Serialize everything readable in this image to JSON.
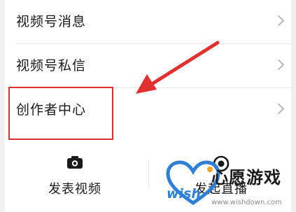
{
  "menu": {
    "items": [
      {
        "label": "视频号消息"
      },
      {
        "label": "视频号私信"
      },
      {
        "label": "创作者中心"
      }
    ]
  },
  "actions": {
    "publish_label": "发表视频",
    "live_label": "发起直播"
  },
  "watermark": {
    "brand_cn": "心愿游戏",
    "brand_logo": "wish",
    "url": "www.wishdown.com"
  },
  "colors": {
    "highlight": "#e0302f",
    "arrow": "#e0302f",
    "heart": "#2f7fd6",
    "heart_accent": "#f5a623"
  },
  "icons": {
    "chevron": "chevron-right-icon",
    "camera": "camera-icon",
    "live": "live-icon"
  }
}
